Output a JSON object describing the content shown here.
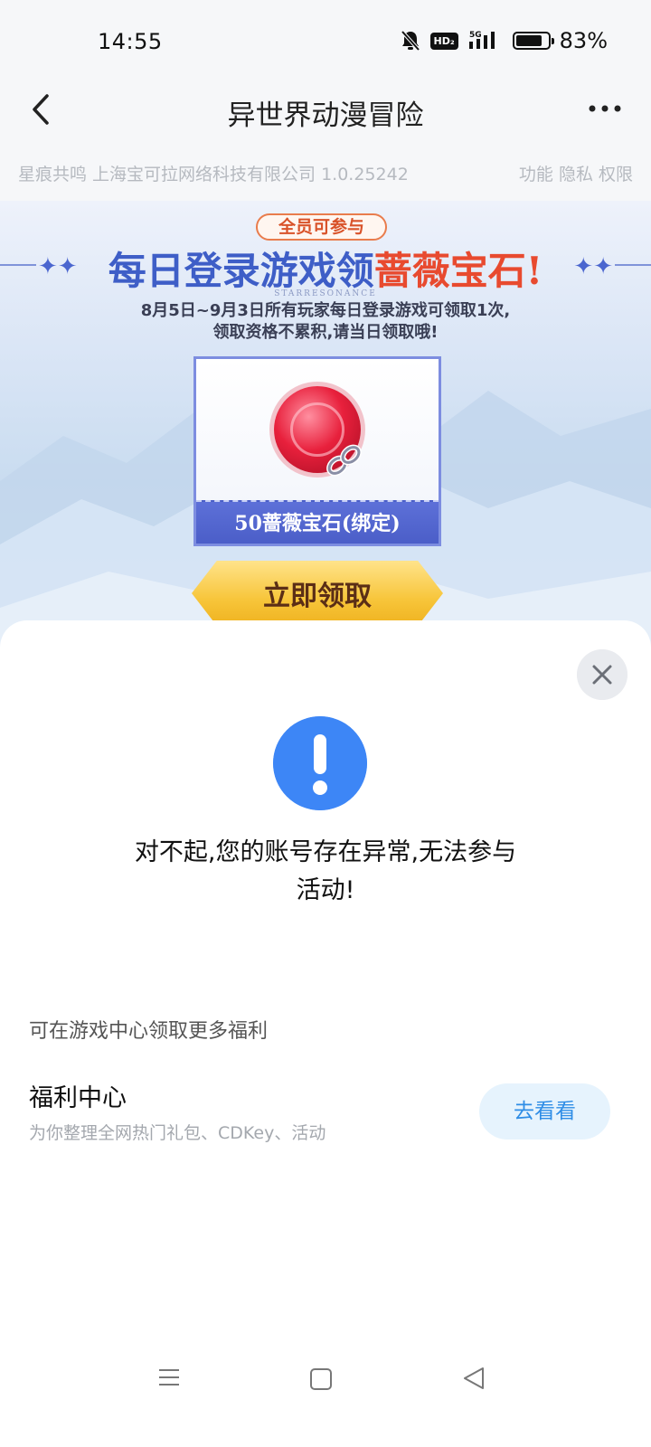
{
  "status_bar": {
    "time": "14:55",
    "hd_badge": "HD₂",
    "network": "5G",
    "battery_level": 0.83,
    "battery_text": "83%",
    "icons": [
      "mute-bell-icon",
      "hd-call-icon",
      "signal-5g-icon",
      "battery-icon"
    ]
  },
  "nav": {
    "title": "异世界动漫冒险",
    "back_icon": "chevron-left-icon",
    "more_icon": "more-dots-icon"
  },
  "info": {
    "left_text": "星痕共鸣 上海宝可拉网络科技有限公司 1.0.25242",
    "right_text": "功能 隐私 权限"
  },
  "banner": {
    "tag": "全员可参与",
    "title_main": "每日登录游戏领",
    "title_highlight": "蔷薇宝石!",
    "subtitle": "STARRESONANCE",
    "desc_line1": "8月5日~9月3日所有玩家每日登录游戏可领取1次,",
    "desc_line2": "领取资格不累积,请当日领取哦!",
    "reward_label": "50蔷薇宝石(绑定)",
    "claim_button": "立即领取",
    "colors": {
      "title": "#3e5ec7",
      "highlight": "#e84a2f",
      "claim": "#f7c53a"
    }
  },
  "sheet": {
    "close_icon": "close-icon",
    "alert_icon": "exclamation-icon",
    "alert_color": "#3d86f6",
    "message_line1": "对不起,您的账号存在异常,无法参与",
    "message_line2": "活动!",
    "more_hint": "可在游戏中心领取更多福利",
    "welfare_title": "福利中心",
    "welfare_desc": "为你整理全网热门礼包、CDKey、活动",
    "go_button": "去看看",
    "go_color": "#2f8de6"
  },
  "system_nav": {
    "icons": [
      "menu-icon",
      "home-icon",
      "back-triangle-icon"
    ]
  }
}
